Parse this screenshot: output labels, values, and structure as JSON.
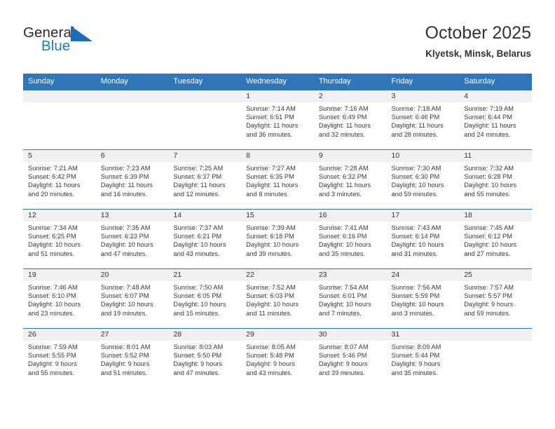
{
  "brand": {
    "name_part1": "General",
    "name_part2": "Blue",
    "logo_icon": "triangle-logo-icon",
    "accent_color": "#1c7cc4"
  },
  "header": {
    "title": "October 2025",
    "location": "Klyetsk, Minsk, Belarus"
  },
  "theme": {
    "header_blue": "#2e76b8",
    "daynum_band": "#f1f1f1",
    "text": "#333333"
  },
  "weekdays": [
    "Sunday",
    "Monday",
    "Tuesday",
    "Wednesday",
    "Thursday",
    "Friday",
    "Saturday"
  ],
  "weeks": [
    [
      {
        "day": "",
        "lines": []
      },
      {
        "day": "",
        "lines": []
      },
      {
        "day": "",
        "lines": []
      },
      {
        "day": "1",
        "lines": [
          "Sunrise: 7:14 AM",
          "Sunset: 6:51 PM",
          "Daylight: 11 hours",
          "and 36 minutes."
        ]
      },
      {
        "day": "2",
        "lines": [
          "Sunrise: 7:16 AM",
          "Sunset: 6:49 PM",
          "Daylight: 11 hours",
          "and 32 minutes."
        ]
      },
      {
        "day": "3",
        "lines": [
          "Sunrise: 7:18 AM",
          "Sunset: 6:46 PM",
          "Daylight: 11 hours",
          "and 28 minutes."
        ]
      },
      {
        "day": "4",
        "lines": [
          "Sunrise: 7:19 AM",
          "Sunset: 6:44 PM",
          "Daylight: 11 hours",
          "and 24 minutes."
        ]
      }
    ],
    [
      {
        "day": "5",
        "lines": [
          "Sunrise: 7:21 AM",
          "Sunset: 6:42 PM",
          "Daylight: 11 hours",
          "and 20 minutes."
        ]
      },
      {
        "day": "6",
        "lines": [
          "Sunrise: 7:23 AM",
          "Sunset: 6:39 PM",
          "Daylight: 11 hours",
          "and 16 minutes."
        ]
      },
      {
        "day": "7",
        "lines": [
          "Sunrise: 7:25 AM",
          "Sunset: 6:37 PM",
          "Daylight: 11 hours",
          "and 12 minutes."
        ]
      },
      {
        "day": "8",
        "lines": [
          "Sunrise: 7:27 AM",
          "Sunset: 6:35 PM",
          "Daylight: 11 hours",
          "and 8 minutes."
        ]
      },
      {
        "day": "9",
        "lines": [
          "Sunrise: 7:28 AM",
          "Sunset: 6:32 PM",
          "Daylight: 11 hours",
          "and 3 minutes."
        ]
      },
      {
        "day": "10",
        "lines": [
          "Sunrise: 7:30 AM",
          "Sunset: 6:30 PM",
          "Daylight: 10 hours",
          "and 59 minutes."
        ]
      },
      {
        "day": "11",
        "lines": [
          "Sunrise: 7:32 AM",
          "Sunset: 6:28 PM",
          "Daylight: 10 hours",
          "and 55 minutes."
        ]
      }
    ],
    [
      {
        "day": "12",
        "lines": [
          "Sunrise: 7:34 AM",
          "Sunset: 6:25 PM",
          "Daylight: 10 hours",
          "and 51 minutes."
        ]
      },
      {
        "day": "13",
        "lines": [
          "Sunrise: 7:35 AM",
          "Sunset: 6:23 PM",
          "Daylight: 10 hours",
          "and 47 minutes."
        ]
      },
      {
        "day": "14",
        "lines": [
          "Sunrise: 7:37 AM",
          "Sunset: 6:21 PM",
          "Daylight: 10 hours",
          "and 43 minutes."
        ]
      },
      {
        "day": "15",
        "lines": [
          "Sunrise: 7:39 AM",
          "Sunset: 6:18 PM",
          "Daylight: 10 hours",
          "and 39 minutes."
        ]
      },
      {
        "day": "16",
        "lines": [
          "Sunrise: 7:41 AM",
          "Sunset: 6:16 PM",
          "Daylight: 10 hours",
          "and 35 minutes."
        ]
      },
      {
        "day": "17",
        "lines": [
          "Sunrise: 7:43 AM",
          "Sunset: 6:14 PM",
          "Daylight: 10 hours",
          "and 31 minutes."
        ]
      },
      {
        "day": "18",
        "lines": [
          "Sunrise: 7:45 AM",
          "Sunset: 6:12 PM",
          "Daylight: 10 hours",
          "and 27 minutes."
        ]
      }
    ],
    [
      {
        "day": "19",
        "lines": [
          "Sunrise: 7:46 AM",
          "Sunset: 6:10 PM",
          "Daylight: 10 hours",
          "and 23 minutes."
        ]
      },
      {
        "day": "20",
        "lines": [
          "Sunrise: 7:48 AM",
          "Sunset: 6:07 PM",
          "Daylight: 10 hours",
          "and 19 minutes."
        ]
      },
      {
        "day": "21",
        "lines": [
          "Sunrise: 7:50 AM",
          "Sunset: 6:05 PM",
          "Daylight: 10 hours",
          "and 15 minutes."
        ]
      },
      {
        "day": "22",
        "lines": [
          "Sunrise: 7:52 AM",
          "Sunset: 6:03 PM",
          "Daylight: 10 hours",
          "and 11 minutes."
        ]
      },
      {
        "day": "23",
        "lines": [
          "Sunrise: 7:54 AM",
          "Sunset: 6:01 PM",
          "Daylight: 10 hours",
          "and 7 minutes."
        ]
      },
      {
        "day": "24",
        "lines": [
          "Sunrise: 7:56 AM",
          "Sunset: 5:59 PM",
          "Daylight: 10 hours",
          "and 3 minutes."
        ]
      },
      {
        "day": "25",
        "lines": [
          "Sunrise: 7:57 AM",
          "Sunset: 5:57 PM",
          "Daylight: 9 hours",
          "and 59 minutes."
        ]
      }
    ],
    [
      {
        "day": "26",
        "lines": [
          "Sunrise: 7:59 AM",
          "Sunset: 5:55 PM",
          "Daylight: 9 hours",
          "and 55 minutes."
        ]
      },
      {
        "day": "27",
        "lines": [
          "Sunrise: 8:01 AM",
          "Sunset: 5:52 PM",
          "Daylight: 9 hours",
          "and 51 minutes."
        ]
      },
      {
        "day": "28",
        "lines": [
          "Sunrise: 8:03 AM",
          "Sunset: 5:50 PM",
          "Daylight: 9 hours",
          "and 47 minutes."
        ]
      },
      {
        "day": "29",
        "lines": [
          "Sunrise: 8:05 AM",
          "Sunset: 5:48 PM",
          "Daylight: 9 hours",
          "and 43 minutes."
        ]
      },
      {
        "day": "30",
        "lines": [
          "Sunrise: 8:07 AM",
          "Sunset: 5:46 PM",
          "Daylight: 9 hours",
          "and 39 minutes."
        ]
      },
      {
        "day": "31",
        "lines": [
          "Sunrise: 8:09 AM",
          "Sunset: 5:44 PM",
          "Daylight: 9 hours",
          "and 35 minutes."
        ]
      },
      {
        "day": "",
        "lines": []
      }
    ]
  ]
}
